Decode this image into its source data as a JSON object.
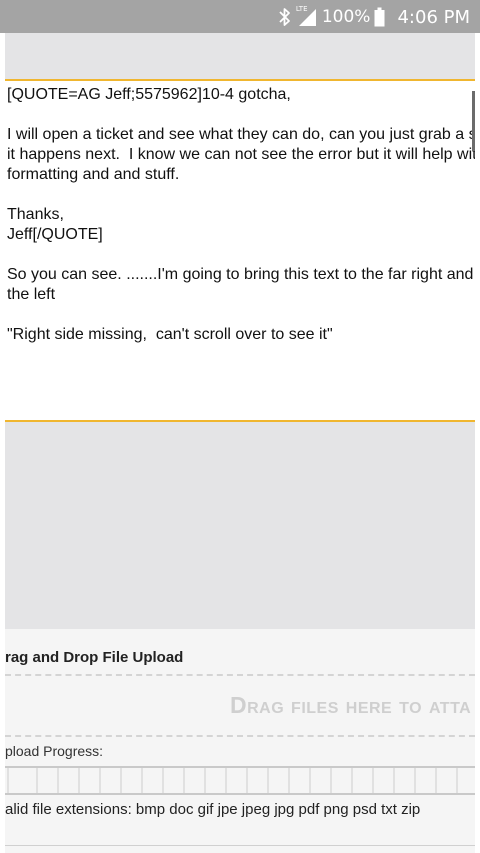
{
  "status_bar": {
    "network_label": "LTE",
    "battery": "100%",
    "time": "4:06 PM"
  },
  "editor": {
    "text": "[QUOTE=AG Jeff;5575962]10-4 gotcha,\n\nI will open a ticket and see what they can do, can you just grab a screenshot when\nit happens next.  I know we can not see the error but it will help with the\nformatting and and stuff.\n\nThanks,\nJeff[/QUOTE]\n\nSo you can see. .......I'm going to bring this text to the far right and it will go off\nthe left\n\n\"Right side missing,  can't scroll over to see it\""
  },
  "upload": {
    "title": "rag and Drop File Upload",
    "drop_text": "Drag files here to atta",
    "progress_label": "pload Progress:",
    "progress_percent": 0,
    "extensions": "alid file extensions: bmp doc gif jpe jpeg jpg pdf png psd txt zip"
  },
  "colors": {
    "status_bar": "#a4a4a4",
    "accent_line": "#f0b62f",
    "panel_grey": "#e4e4e6"
  }
}
